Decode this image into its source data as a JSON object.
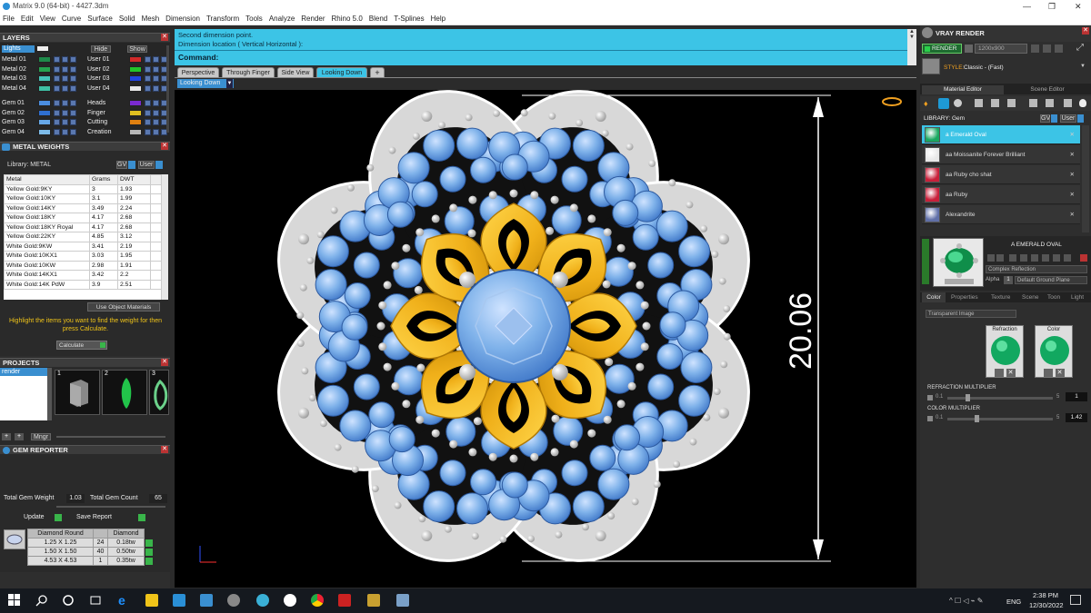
{
  "window": {
    "title": "Matrix 9.0 (64-bit) - 4427.3dm"
  },
  "menu": [
    "File",
    "Edit",
    "View",
    "Curve",
    "Surface",
    "Solid",
    "Mesh",
    "Dimension",
    "Transform",
    "Tools",
    "Analyze",
    "Render",
    "Rhino 5.0",
    "Blend",
    "T-Splines",
    "Help"
  ],
  "layers": {
    "title": "LAYERS",
    "lights_label": "Lights",
    "hide_label": "Hide",
    "show_label": "Show",
    "left": [
      {
        "name": "Metal 01",
        "color": "#1e8a4a"
      },
      {
        "name": "Metal 02",
        "color": "#25a34f"
      },
      {
        "name": "Metal 03",
        "color": "#45c5b8"
      },
      {
        "name": "Metal 04",
        "color": "#3fbfa5"
      },
      {
        "name": "Gem 01",
        "color": "#4b8ee0"
      },
      {
        "name": "Gem 02",
        "color": "#2f6fd0"
      },
      {
        "name": "Gem 03",
        "color": "#66a8e8"
      },
      {
        "name": "Gem 04",
        "color": "#7dbbe8"
      }
    ],
    "right": [
      {
        "name": "User 01",
        "color": "#d22a2a"
      },
      {
        "name": "User 02",
        "color": "#22c42a"
      },
      {
        "name": "User 03",
        "color": "#2244e0"
      },
      {
        "name": "User 04",
        "color": "#e8e8e8"
      },
      {
        "name": "Heads",
        "color": "#7a2ad0"
      },
      {
        "name": "Finger",
        "color": "#e0c020"
      },
      {
        "name": "Cutting",
        "color": "#e08010"
      },
      {
        "name": "Creation",
        "color": "#b8b8b8"
      }
    ]
  },
  "metal_weights": {
    "title": "METAL WEIGHTS",
    "library_label": "Library: METAL",
    "gv": "GV",
    "user": "User",
    "columns": [
      "Metal",
      "Grams",
      "DWT"
    ],
    "rows": [
      [
        "Yellow Gold:9KY",
        "3",
        "1.93"
      ],
      [
        "Yellow Gold:10KY",
        "3.1",
        "1.99"
      ],
      [
        "Yellow Gold:14KY",
        "3.49",
        "2.24"
      ],
      [
        "Yellow Gold:18KY",
        "4.17",
        "2.68"
      ],
      [
        "Yellow Gold:18KY Royal",
        "4.17",
        "2.68"
      ],
      [
        "Yellow Gold:22KY",
        "4.85",
        "3.12"
      ],
      [
        "White Gold:9KW",
        "3.41",
        "2.19"
      ],
      [
        "White Gold:10KX1",
        "3.03",
        "1.95"
      ],
      [
        "White Gold:10KW",
        "2.98",
        "1.91"
      ],
      [
        "White Gold:14KX1",
        "3.42",
        "2.2"
      ],
      [
        "White Gold:14K PdW",
        "3.9",
        "2.51"
      ]
    ],
    "use_object_materials": "Use Object Materials",
    "hint": "Highlight the items you want to find the weight for then press Calculate.",
    "calculate": "Calculate"
  },
  "projects": {
    "title": "PROJECTS",
    "item": "render",
    "thumb_numbers": [
      "1",
      "2",
      "3"
    ],
    "mngr": "Mngr"
  },
  "gem_reporter": {
    "title": "GEM REPORTER",
    "total_weight_label": "Total Gem Weight",
    "total_weight": "1.03",
    "total_count_label": "Total Gem Count",
    "total_count": "65",
    "update": "Update",
    "save_report": "Save Report",
    "columns": [
      "Diamond Round",
      "",
      "Diamond"
    ],
    "rows": [
      [
        "1.25 X 1.25",
        "24",
        "0.18tw"
      ],
      [
        "1.50 X 1.50",
        "40",
        "0.50tw"
      ],
      [
        "4.53 X 4.53",
        "1",
        "0.35tw"
      ]
    ]
  },
  "command": {
    "line1": "Second dimension point.",
    "line2": "Dimension location ( Vertical  Horizontal ):",
    "prompt": "Command:"
  },
  "view_tabs": [
    "Perspective",
    "Through Finger",
    "Side View",
    "Looking Down"
  ],
  "active_tab": "Looking Down",
  "view_dropdown": "Looking Down",
  "dimension_value": "20.06",
  "vray": {
    "title": "VRAY RENDER",
    "render_btn": "RENDER",
    "resolution": "1200x900",
    "style_label": "STYLE:",
    "style_value": "Classic - (Fast)",
    "tabs": [
      "Material Editor",
      "Scene Editor"
    ],
    "library_label": "LIBRARY: Gem",
    "gv": "GV",
    "user": "User",
    "materials": [
      {
        "name": "a Emerald Oval",
        "color": "#1aa860",
        "selected": true
      },
      {
        "name": "aa Moissanite Forever Brilliant",
        "color": "#e8e8e8",
        "selected": false
      },
      {
        "name": "aa Ruby cho shat",
        "color": "#c8203a",
        "selected": false
      },
      {
        "name": "aa Ruby",
        "color": "#c8203a",
        "selected": false
      },
      {
        "name": "Alexandrite",
        "color": "#6070a8",
        "selected": false
      }
    ],
    "preview_name": "A EMERALD OVAL",
    "complex_reflection": "Complex Reflection",
    "alpha_label": "Alpha",
    "alpha_value": "1",
    "default_ground": "Default Ground Plane",
    "subtabs": [
      "Color",
      "Properties",
      "Texture",
      "Scene",
      "Toon",
      "Light"
    ],
    "transparent_image": "Transparent Image",
    "refraction_label": "Refraction",
    "color_label": "Color",
    "refraction_multiplier_label": "REFRACTION MULTIPLIER",
    "refraction_min": "0.1",
    "refraction_max": "5",
    "refraction_value": "1",
    "color_multiplier_label": "COLOR MULTIPLIER",
    "color_min": "0.1",
    "color_max": "5",
    "color_value": "1.42"
  },
  "taskbar": {
    "lang": "ENG",
    "time": "2:38 PM",
    "date": "12/30/2022"
  }
}
